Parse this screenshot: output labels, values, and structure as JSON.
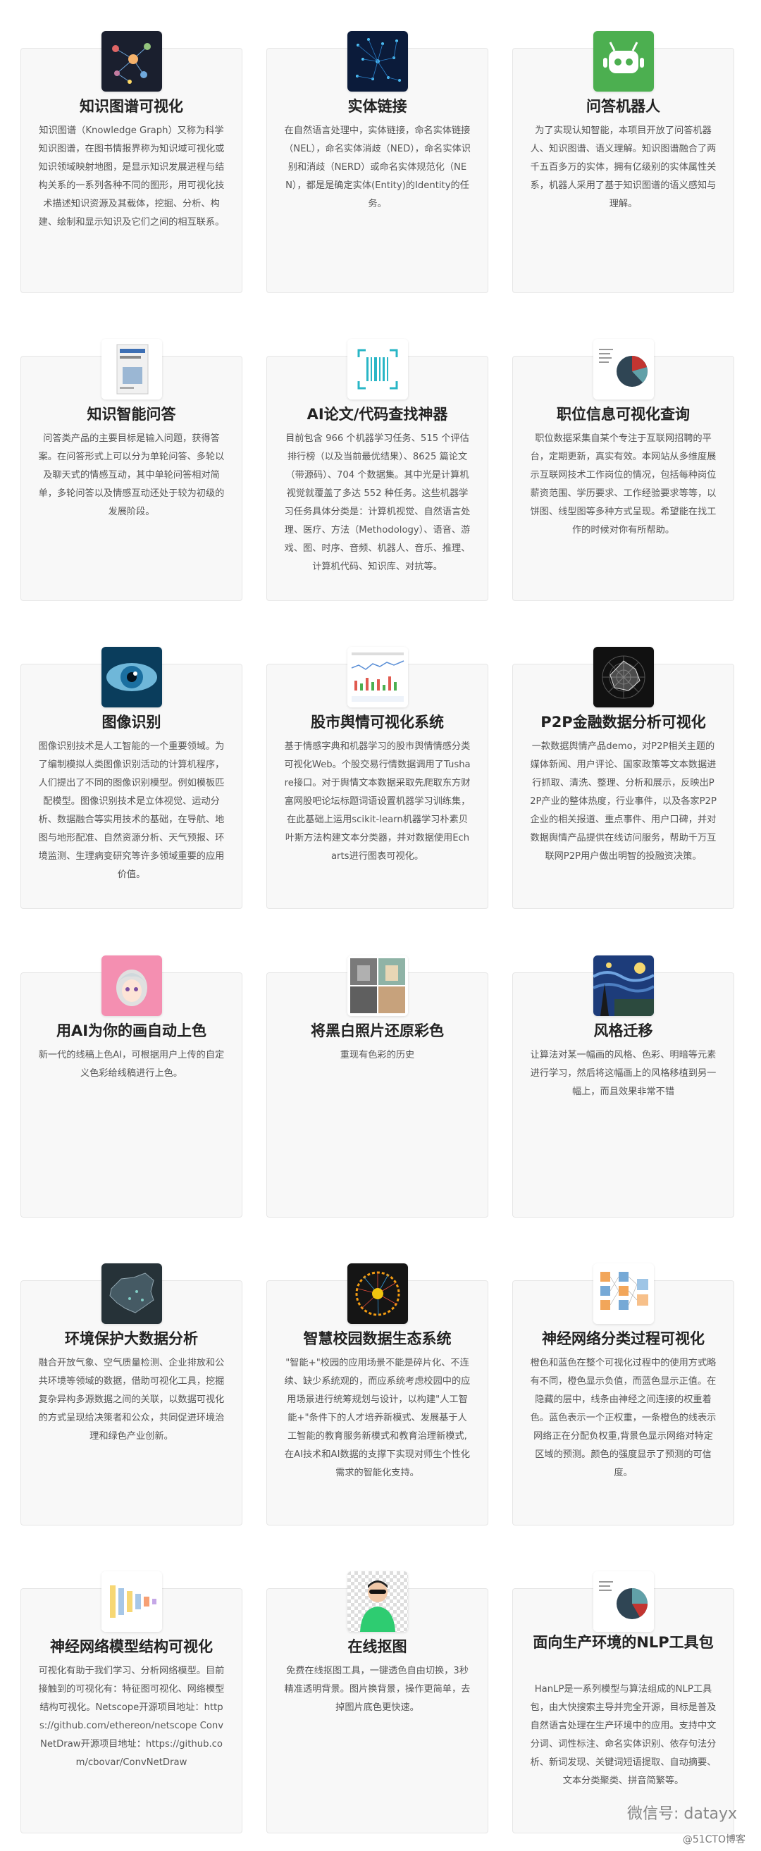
{
  "cards": [
    {
      "title": "知识图谱可视化",
      "icon": "knowledge-graph-icon",
      "desc": "知识图谱（Knowledge Graph）又称为科学知识图谱，在图书情报界称为知识域可视化或知识领域映射地图，是显示知识发展进程与结构关系的一系列各种不同的图形，用可视化技术描述知识资源及其载体，挖掘、分析、构建、绘制和显示知识及它们之间的相互联系。"
    },
    {
      "title": "实体链接",
      "icon": "network-icon",
      "desc": "在自然语言处理中，实体链接，命名实体链接（NEL），命名实体消歧（NED），命名实体识别和消歧（NERD）或命名实体规范化（NEN），都是是确定实体(Entity)的Identity的任务。"
    },
    {
      "title": "问答机器人",
      "icon": "robot-icon",
      "desc": "为了实现认知智能，本项目开放了问答机器人、知识图谱、语义理解。知识图谱融合了两千五百多万的实体，拥有亿级别的实体属性关系，机器人采用了基于知识图谱的语义感知与理解。"
    },
    {
      "title": "知识智能问答",
      "icon": "book-icon",
      "desc": "问答类产品的主要目标是输入问题，获得答案。在问答形式上可以分为单轮问答、多轮以及聊天式的情感互动，其中单轮问答相对简单，多轮问答以及情感互动还处于较为初级的发展阶段。"
    },
    {
      "title": "AI论文/代码查找神器",
      "icon": "scan-icon",
      "desc": "目前包含 966 个机器学习任务、515 个评估排行榜（以及当前最优结果）、8625 篇论文（带源码）、704 个数据集。其中光是计算机视觉就覆盖了多达 552 种任务。这些机器学习任务具体分类是：计算机视觉、自然语言处理、医疗、方法（Methodology）、语音、游戏、图、时序、音频、机器人、音乐、推理、计算机代码、知识库、对抗等。"
    },
    {
      "title": "职位信息可视化查询",
      "icon": "pie-chart-icon",
      "desc": "职位数据采集自某个专注于互联网招聘的平台，定期更新，真实有效。本网站从多维度展示互联网技术工作岗位的情况，包括每种岗位薪资范围、学历要求、工作经验要求等等，以饼图、线型图等多种方式呈现。希望能在找工作的时候对你有所帮助。"
    },
    {
      "title": "图像识别",
      "icon": "eye-icon",
      "desc": "图像识别技术是人工智能的一个重要领域。为了编制模拟人类图像识别活动的计算机程序，人们提出了不同的图像识别模型。例如模板匹配模型。图像识别技术是立体视觉、运动分析、数据融合等实用技术的基础，在导航、地图与地形配准、自然资源分析、天气预报、环境监测、生理病变研究等许多领域重要的应用价值。"
    },
    {
      "title": "股市舆情可视化系统",
      "icon": "stock-chart-icon",
      "desc": "基于情感字典和机器学习的股市舆情情感分类可视化Web。个股交易行情数据调用了Tushare接口。对于舆情文本数据采取先爬取东方财富网股吧论坛标题词语设置机器学习训练集，在此基础上运用scikit-learn机器学习朴素贝叶斯方法构建文本分类器，并对数据使用Echarts进行图表可视化。"
    },
    {
      "title": "P2P金融数据分析可视化",
      "icon": "radar-chart-icon",
      "desc": "一款数据舆情产品demo，对P2P相关主题的媒体新闻、用户评论、国家政策等文本数据进行抓取、清洗、整理、分析和展示，反映出P2P产业的整体热度，行业事件，以及各家P2P企业的相关报道、重点事件、用户口碑，并对数据舆情产品提供在线访问服务，帮助千万互联网P2P用户做出明智的投融资决策。"
    },
    {
      "title": "用AI为你的画自动上色",
      "icon": "anime-girl-icon",
      "desc": "新一代的线稿上色AI，可根据用户上传的自定义色彩给线稿进行上色。"
    },
    {
      "title": "将黑白照片还原彩色",
      "icon": "photo-icon",
      "desc": "重现有色彩的历史"
    },
    {
      "title": "风格迁移",
      "icon": "starry-night-icon",
      "desc": "让算法对某一幅画的风格、色彩、明暗等元素进行学习，然后将这幅画上的风格移植到另一幅上，而且效果非常不错"
    },
    {
      "title": "环境保护大数据分析",
      "icon": "china-map-icon",
      "desc": "融合开放气象、空气质量检测、企业排放和公共环境等领域的数据，借助可视化工具，挖掘复杂异构多源数据之间的关联，以数据可视化的方式呈现给决策者和公众，共同促进环境治理和绿色产业创新。"
    },
    {
      "title": "智慧校园数据生态系统",
      "icon": "radial-viz-icon",
      "desc": "\"智能+\"校园的应用场景不能是碎片化、不连续、缺少系统观的，而应系统考虑校园中的应用场景进行统筹规划与设计，以构建\"人工智能+\"条件下的人才培养新模式、发展基于人工智能的教育服务新模式和教育治理新模式,在AI技术和AI数据的支撑下实现对师生个性化需求的智能化支持。"
    },
    {
      "title": "神经网络分类过程可视化",
      "icon": "neural-grid-icon",
      "desc": "橙色和蓝色在整个可视化过程中的使用方式略有不同，橙色显示负值，而蓝色显示正值。在隐藏的层中，线条由神经之间连接的权重着色。蓝色表示一个正权重，一条橙色的线表示网络正在分配负权重,背景色显示网络对特定区域的预测。颜色的强度显示了预测的可信度。"
    },
    {
      "title": "神经网络模型结构可视化",
      "icon": "network-layers-icon",
      "desc": "可视化有助于我们学习、分析网络模型。目前接触到的可视化有：特征图可视化、网络模型结构可视化。Netscope开源项目地址：https://github.com/ethereon/netscope ConvNetDraw开源项目地址：https://github.com/cbovar/ConvNetDraw"
    },
    {
      "title": "在线抠图",
      "icon": "portrait-icon",
      "desc": "免费在线抠图工具，一键透色自由切换，3秒精准透明背景。图片换背景，操作更简单，去掉图片底色更快速。"
    },
    {
      "title": "面向生产环境的NLP工具包",
      "icon": "pie-chart-icon",
      "desc": "HanLP是一系列模型与算法组成的NLP工具包，由大快搜索主导并完全开源，目标是普及自然语言处理在生产环境中的应用。支持中文分词、词性标注、命名实体识别、依存句法分析、新词发现、关键词短语提取、自动摘要、文本分类聚类、拼音简繁等。"
    }
  ],
  "watermark": "微信号: datayx",
  "watermark2": "@51CTO博客"
}
